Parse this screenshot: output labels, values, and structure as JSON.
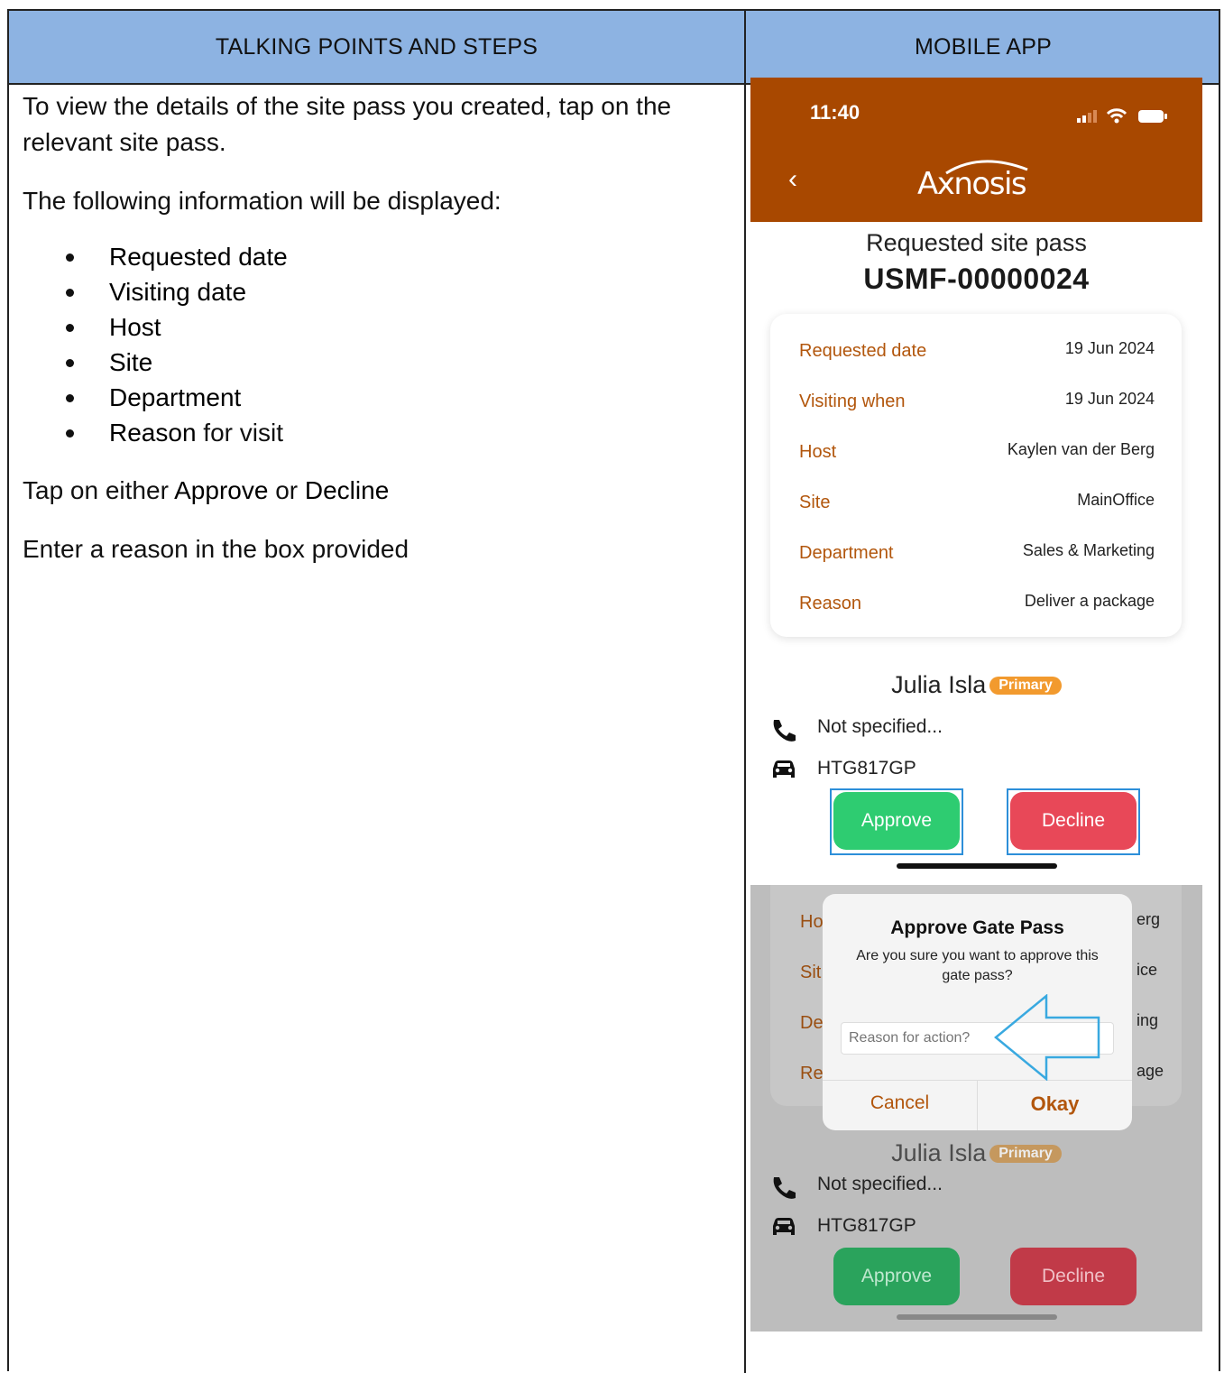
{
  "table": {
    "header_left": "TALKING POINTS AND STEPS",
    "header_right": "MOBILE APP"
  },
  "steps": {
    "intro": "To view the details of the site pass you created, tap on the relevant site pass.",
    "following": "The following information will be displayed:",
    "list": [
      {
        "bold": "Requested date",
        "rest": ""
      },
      {
        "bold": "Visiting date",
        "rest": ""
      },
      {
        "bold": "Host",
        "rest": ""
      },
      {
        "bold": "Site",
        "rest": ""
      },
      {
        "bold": "Department",
        "rest": ""
      },
      {
        "bold": "Reason",
        "rest": " for visit"
      }
    ],
    "tap_prefix": "Tap on either ",
    "tap_approve": "Approve",
    "tap_or": " or ",
    "tap_decline": "Decline",
    "enter": "Enter a reason in the box provided"
  },
  "app": {
    "time": "11:40",
    "logo": "Axnosis",
    "screen_title": "Requested site pass",
    "pass_id": "USMF-00000024",
    "details": [
      {
        "label": "Requested date",
        "value": "19 Jun 2024"
      },
      {
        "label": "Visiting when",
        "value": "19 Jun 2024"
      },
      {
        "label": "Host",
        "value": "Kaylen van der Berg"
      },
      {
        "label": "Site",
        "value": "MainOffice"
      },
      {
        "label": "Department",
        "value": "Sales & Marketing"
      },
      {
        "label": "Reason",
        "value": "Deliver a package"
      }
    ],
    "visitor_name": "Julia Isla",
    "visitor_badge": "Primary",
    "phone": "Not specified...",
    "vehicle": "HTG817GP",
    "approve_label": "Approve",
    "decline_label": "Decline",
    "colors": {
      "nav": "#a84800",
      "label": "#b2560c",
      "approve": "#2ecc71",
      "decline": "#e84858",
      "badge": "#f29a2e"
    }
  },
  "dialog": {
    "title": "Approve Gate Pass",
    "message": "Are you sure you want to approve this gate pass?",
    "input_placeholder": "Reason for action?",
    "cancel": "Cancel",
    "okay": "Okay",
    "bg_fragments": [
      "Ho",
      "Sit",
      "De",
      "Re",
      "erg",
      "ice",
      "ing",
      "age"
    ]
  }
}
